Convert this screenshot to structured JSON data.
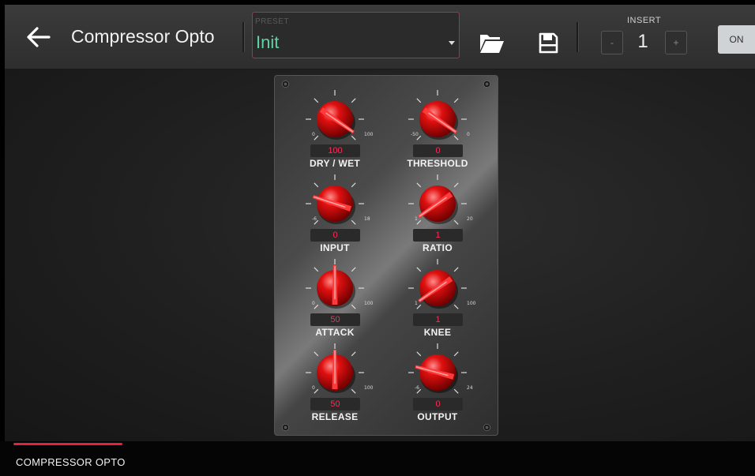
{
  "header": {
    "title": "Compressor Opto",
    "preset": {
      "label": "PRESET",
      "value": "Init"
    },
    "insert": {
      "label": "INSERT",
      "value": "1",
      "decrement": "-",
      "increment": "+"
    },
    "on_label": "ON"
  },
  "knobs": {
    "dry_wet": {
      "label": "DRY / WET",
      "value": "100",
      "min": "0",
      "max": "100"
    },
    "threshold": {
      "label": "THRESHOLD",
      "value": "0",
      "min": "-50",
      "max": "0"
    },
    "input": {
      "label": "INPUT",
      "value": "0",
      "min": "-6",
      "max": "18"
    },
    "ratio": {
      "label": "RATIO",
      "value": "1",
      "min": "1",
      "max": "20"
    },
    "attack": {
      "label": "ATTACK",
      "value": "50",
      "min": "0",
      "max": "100"
    },
    "knee": {
      "label": "KNEE",
      "value": "1",
      "min": "1",
      "max": "100"
    },
    "release": {
      "label": "RELEASE",
      "value": "50",
      "min": "0",
      "max": "100"
    },
    "output": {
      "label": "OUTPUT",
      "value": "0",
      "min": "-6",
      "max": "24"
    }
  },
  "footer": {
    "tab": "COMPRESSOR OPTO"
  },
  "colors": {
    "accent": "#e4223e",
    "preset_text": "#5fd3a6",
    "value_text": "#ff2b55",
    "knob": "#e01010"
  },
  "icons": {
    "back": "arrow-left-icon",
    "folder": "folder-open-icon",
    "save": "floppy-disk-icon"
  }
}
